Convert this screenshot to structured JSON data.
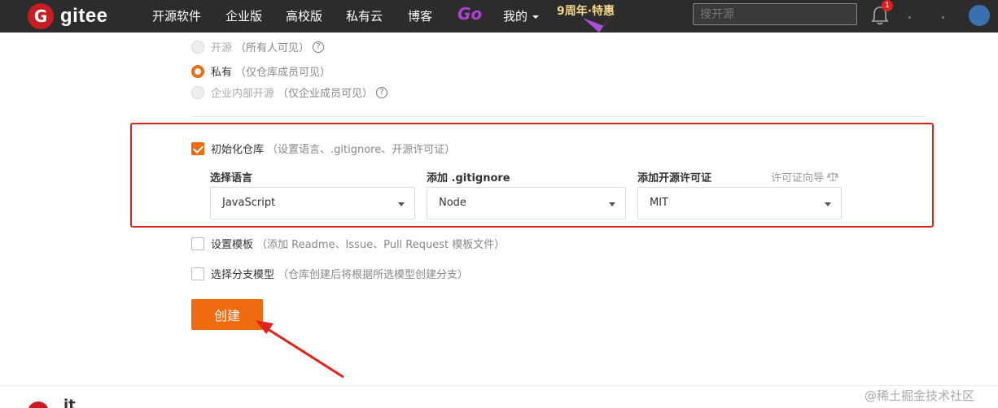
{
  "navbar": {
    "logo_letter": "G",
    "logo_text": "gitee",
    "items": [
      "开源软件",
      "企业版",
      "高校版",
      "私有云",
      "博客"
    ],
    "go_label": "Go",
    "mine_label": "我的",
    "anniversary": "9周年·特惠",
    "search_placeholder": "搜开源",
    "notification_count": "1"
  },
  "visibility": {
    "options": [
      {
        "label": "开源",
        "hint": "（所有人可见）",
        "help": "?",
        "checked": false,
        "disabled": true
      },
      {
        "label": "私有",
        "hint": "（仅仓库成员可见）",
        "help": "",
        "checked": true,
        "disabled": false
      },
      {
        "label": "企业内部开源",
        "hint": "（仅企业成员可见）",
        "help": "?",
        "checked": false,
        "disabled": true
      }
    ]
  },
  "init_repo": {
    "label": "初始化仓库",
    "hint": "（设置语言、.gitignore、开源许可证）",
    "checked": true,
    "language": {
      "label": "选择语言",
      "value": "JavaScript"
    },
    "gitignore": {
      "label": "添加 .gitignore",
      "value": "Node"
    },
    "license": {
      "label": "添加开源许可证",
      "value": "MIT",
      "guide": "许可证向导"
    }
  },
  "template": {
    "label": "设置模板",
    "hint": "（添加 Readme、Issue、Pull Request 模板文件）",
    "checked": false
  },
  "branch_model": {
    "label": "选择分支模型",
    "hint": "（仓库创建后将根据所选模型创建分支）",
    "checked": false
  },
  "create_button": "创建",
  "footer": {
    "logo_text": "it"
  },
  "watermark": "@稀土掘金技术社区",
  "colors": {
    "accent": "#f06a0f",
    "highlight": "#e0241b",
    "navbar": "#2c2c2c"
  }
}
